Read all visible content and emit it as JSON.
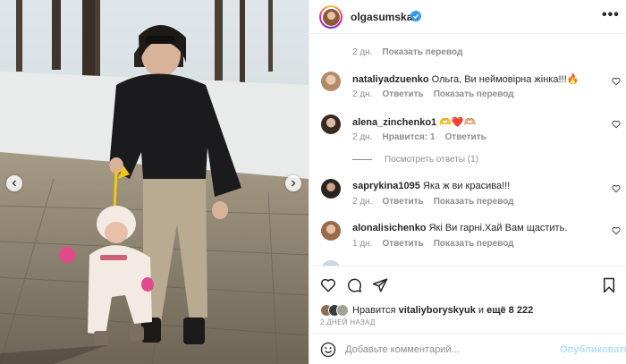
{
  "post": {
    "username": "olgasumska",
    "more_label": "•••"
  },
  "comments": [
    {
      "username": "",
      "text": "",
      "time": "2 дн.",
      "translate": "Показать перевод"
    },
    {
      "username": "nataliyadzuenko",
      "text": "Ольга, Ви неймовірна жінка!!!🔥",
      "time": "2 дн.",
      "reply": "Ответить",
      "translate": "Показать перевод"
    },
    {
      "username": "alena_zinchenko1",
      "text": "🫶❤️🫶🏼",
      "time": "2 дн.",
      "likes": "Нравится: 1",
      "reply": "Ответить"
    },
    {
      "username": "saprykina1095",
      "text": "Яка ж ви красива!!!",
      "time": "2 дн.",
      "reply": "Ответить",
      "translate": "Показать перевод"
    },
    {
      "username": "alonalisichenko",
      "text": "Які Ви гарні.Хай Вам щастить.",
      "time": "1 дн.",
      "reply": "Ответить",
      "translate": "Показать перевод"
    }
  ],
  "view_replies": "Посмотреть ответы (1)",
  "likes": {
    "prefix": "Нравится",
    "user": "vitaliyboryskyuk",
    "conj": "и",
    "more": "ещё 8 222"
  },
  "date": "2 ДНЕЙ НАЗАД",
  "comment_box": {
    "placeholder": "Добавьте комментарий...",
    "publish": "Опубликовать"
  },
  "icons": {
    "like": "heart-icon",
    "comment": "comment-icon",
    "share": "paper-plane-icon",
    "save": "bookmark-icon",
    "emoji": "smiley-icon"
  },
  "colors": {
    "verified": "#3897f0",
    "muted": "#8e8e8e",
    "publish_disabled": "#b2dffc"
  }
}
